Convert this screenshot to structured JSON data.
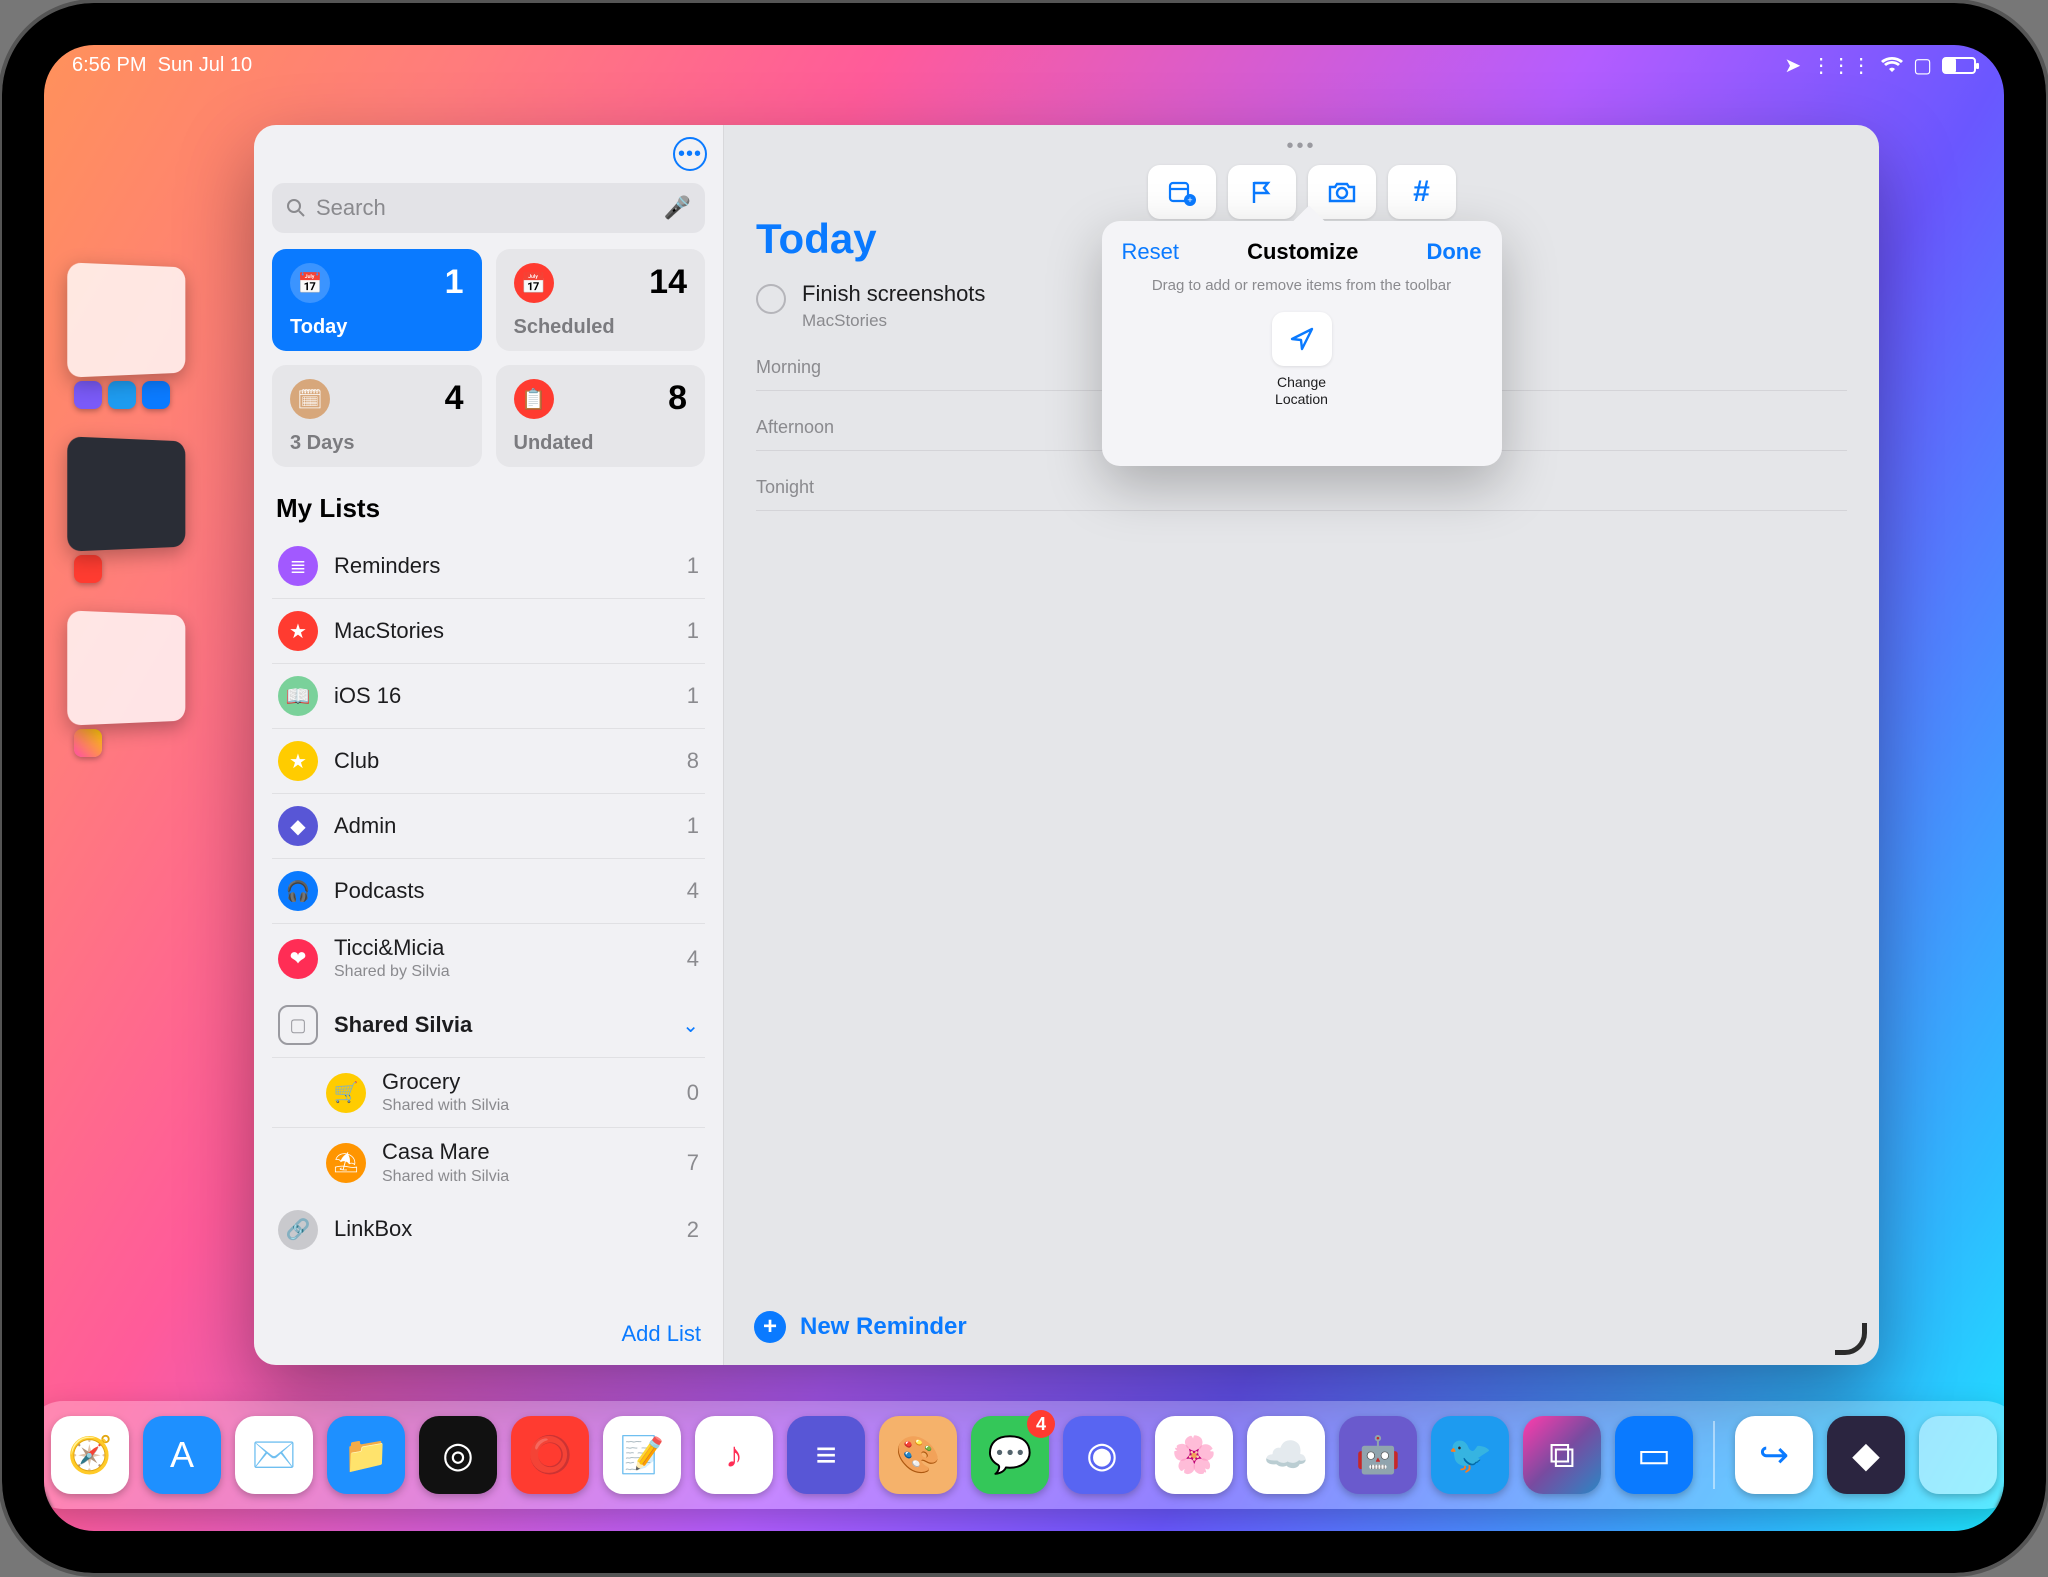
{
  "status": {
    "time": "6:56 PM",
    "date": "Sun Jul 10"
  },
  "search": {
    "placeholder": "Search"
  },
  "smart": [
    {
      "key": "today",
      "label": "Today",
      "count": 1,
      "style": "blue",
      "icon": "📅",
      "ibg": "#ffffff33"
    },
    {
      "key": "scheduled",
      "label": "Scheduled",
      "count": 14,
      "style": "grey",
      "icon": "📅",
      "ibg": "#ff3b30"
    },
    {
      "key": "3days",
      "label": "3 Days",
      "count": 4,
      "style": "grey",
      "icon": "🗓",
      "ibg": "#d7a77b"
    },
    {
      "key": "undated",
      "label": "Undated",
      "count": 8,
      "style": "grey",
      "icon": "📋",
      "ibg": "#ff3b30"
    }
  ],
  "mylists_header": "My Lists",
  "lists": [
    {
      "name": "Reminders",
      "count": 1,
      "color": "#a259ff",
      "glyph": "≣"
    },
    {
      "name": "MacStories",
      "count": 1,
      "color": "#ff3b30",
      "glyph": "★"
    },
    {
      "name": "iOS 16",
      "count": 1,
      "color": "#7ad19a",
      "glyph": "📖"
    },
    {
      "name": "Club",
      "count": 8,
      "color": "#ffcc00",
      "glyph": "★"
    },
    {
      "name": "Admin",
      "count": 1,
      "color": "#5856d6",
      "glyph": "◆"
    },
    {
      "name": "Podcasts",
      "count": 4,
      "color": "#0a7aff",
      "glyph": "🎧"
    },
    {
      "name": "Ticci&Micia",
      "count": 4,
      "color": "#ff2d55",
      "glyph": "❤",
      "sub": "Shared by Silvia"
    }
  ],
  "group": {
    "name": "Shared Silvia"
  },
  "group_items": [
    {
      "name": "Grocery",
      "count": 0,
      "color": "#ffcc00",
      "glyph": "🛒",
      "sub": "Shared with Silvia"
    },
    {
      "name": "Casa Mare",
      "count": 7,
      "color": "#ff9500",
      "glyph": "⛱",
      "sub": "Shared with Silvia"
    }
  ],
  "linkbox": {
    "name": "LinkBox",
    "count": 2
  },
  "add_list": "Add List",
  "main": {
    "title": "Today",
    "task": {
      "title": "Finish screenshots",
      "sub": "MacStories"
    },
    "sections": [
      "Morning",
      "Afternoon",
      "Tonight"
    ],
    "new_reminder": "New Reminder"
  },
  "popover": {
    "reset": "Reset",
    "title": "Customize",
    "done": "Done",
    "hint": "Drag to add or remove items from the toolbar",
    "item_label": "Change\nLocation"
  },
  "dock_badge": 4
}
